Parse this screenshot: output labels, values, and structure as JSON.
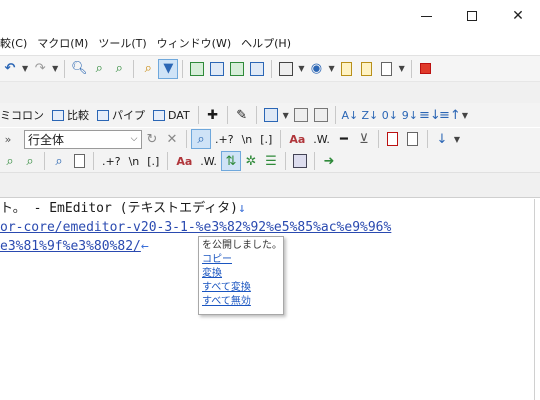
{
  "window": {
    "minimize_glyph": "",
    "close_glyph": "✕"
  },
  "menu": [
    "較(C)",
    "マクロ(M)",
    "ツール(T)",
    "ウィンドウ(W)",
    "ヘルプ(H)"
  ],
  "toolbar2": {
    "buttons": [
      "ミコロン",
      "比較",
      "パイプ",
      "DAT"
    ]
  },
  "search_toolbar": {
    "scope_value": "行全体",
    "regex_label": ".+?",
    "newline_label": "\\n",
    "bracket_label": "[.]",
    "case_label": "Aa",
    "word_label": ".W."
  },
  "toolbar4": {
    "regex_label": ".+?",
    "newline_label": "\\n",
    "bracket_label": "[.]",
    "case_label": "Aa",
    "word_label": ".W."
  },
  "editor": {
    "line1": "ト。 - EmEditor (テキストエディタ)",
    "line1_eol": "↓",
    "line2_url": "or-core/emeditor-v20-3-1-%e3%82%92%e5%85%ac%e9%96%",
    "line3_url": "e3%81%9f%e3%80%82/",
    "line3_eol": "←"
  },
  "popup": {
    "message": "を公開しました。",
    "items": [
      "コピー",
      "変換",
      "すべて変換",
      "すべて無効"
    ]
  },
  "colors": {
    "accent": "#2b66b5",
    "link": "#2a4ab0",
    "toolbar_bg": "#f3f3f3"
  }
}
